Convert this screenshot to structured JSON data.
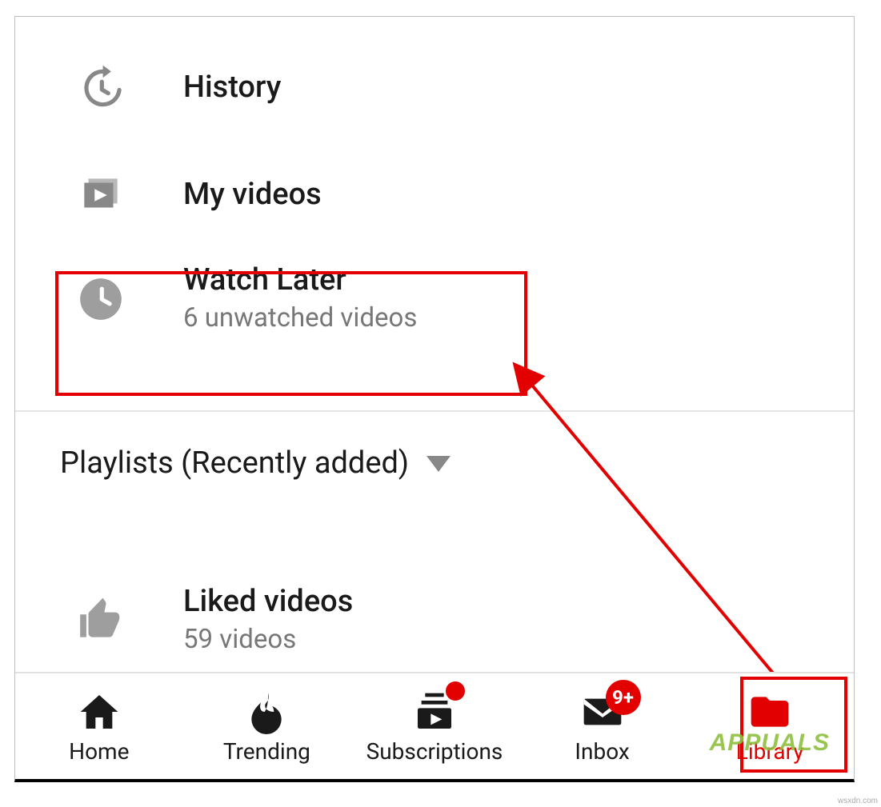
{
  "library": {
    "history_label": "History",
    "my_videos_label": "My videos",
    "watch_later": {
      "label": "Watch Later",
      "subtitle": "6 unwatched videos"
    },
    "playlists_header": "Playlists (Recently added)",
    "liked": {
      "label": "Liked videos",
      "subtitle": "59 videos"
    }
  },
  "bottom_nav": {
    "home": "Home",
    "trending": "Trending",
    "subscriptions": "Subscriptions",
    "inbox": "Inbox",
    "inbox_badge": "9+",
    "library": "Library"
  },
  "watermark": "APPUALS",
  "footnote": "wsxdn.com"
}
